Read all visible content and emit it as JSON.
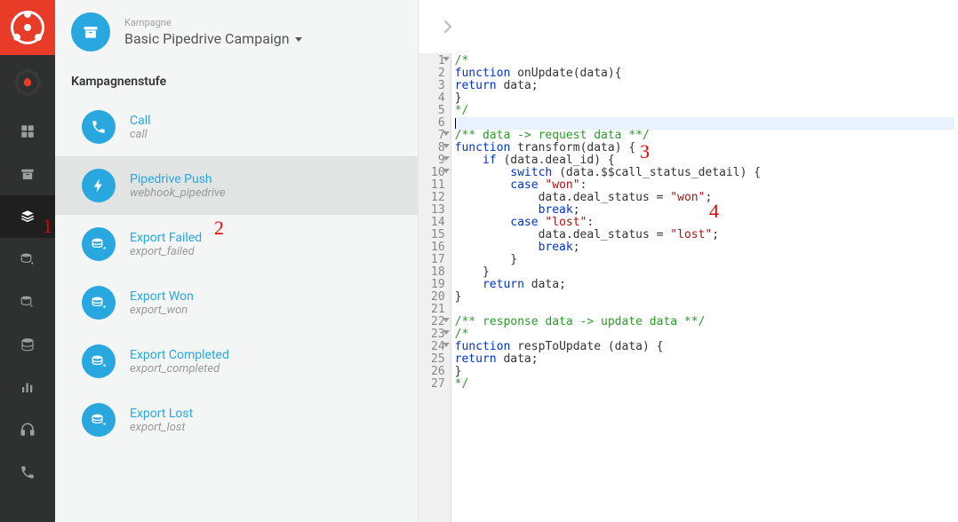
{
  "header": {
    "label": "Kampagne",
    "title": "Basic Pipedrive Campaign"
  },
  "section_label": "Kampagnenstufe",
  "stages": [
    {
      "title": "Call",
      "sub": "call",
      "icon": "phone"
    },
    {
      "title": "Pipedrive Push",
      "sub": "webhook_pipedrive",
      "icon": "bolt"
    },
    {
      "title": "Export Failed",
      "sub": "export_failed",
      "icon": "db-arrow"
    },
    {
      "title": "Export Won",
      "sub": "export_won",
      "icon": "db-arrow"
    },
    {
      "title": "Export Completed",
      "sub": "export_completed",
      "icon": "db-arrow"
    },
    {
      "title": "Export Lost",
      "sub": "export_lost",
      "icon": "db-arrow"
    }
  ],
  "selected_stage_index": 1,
  "nav_active_index": 2,
  "annotations": {
    "a1": "1",
    "a2": "2",
    "a3": "3",
    "a4": "4"
  },
  "code": {
    "total_lines": 27,
    "fold_lines": [
      1,
      7,
      8,
      9,
      10,
      22,
      23,
      24
    ],
    "highlight_line": 6,
    "lines": [
      [
        {
          "c": "comment",
          "t": "/*"
        }
      ],
      [
        {
          "c": "kw",
          "t": "function"
        },
        {
          "c": "plain",
          "t": " onUpdate(data){"
        }
      ],
      [
        {
          "c": "kw",
          "t": "return"
        },
        {
          "c": "plain",
          "t": " data;"
        }
      ],
      [
        {
          "c": "plain",
          "t": "}"
        }
      ],
      [
        {
          "c": "comment",
          "t": "*/"
        }
      ],
      [
        {
          "c": "cursor",
          "t": ""
        }
      ],
      [
        {
          "c": "comment",
          "t": "/** data -> request data **/"
        }
      ],
      [
        {
          "c": "kw",
          "t": "function"
        },
        {
          "c": "plain",
          "t": " "
        },
        {
          "c": "fn",
          "t": "transform"
        },
        {
          "c": "plain",
          "t": "(data) {"
        }
      ],
      [
        {
          "c": "plain",
          "t": "    "
        },
        {
          "c": "kw",
          "t": "if"
        },
        {
          "c": "plain",
          "t": " (data.deal_id) {"
        }
      ],
      [
        {
          "c": "plain",
          "t": "        "
        },
        {
          "c": "kw",
          "t": "switch"
        },
        {
          "c": "plain",
          "t": " (data.$$call_status_detail) {"
        }
      ],
      [
        {
          "c": "plain",
          "t": "        "
        },
        {
          "c": "kw",
          "t": "case"
        },
        {
          "c": "plain",
          "t": " "
        },
        {
          "c": "str",
          "t": "\"won\""
        },
        {
          "c": "plain",
          "t": ":"
        }
      ],
      [
        {
          "c": "plain",
          "t": "            data.deal_status = "
        },
        {
          "c": "str",
          "t": "\"won\""
        },
        {
          "c": "plain",
          "t": ";"
        }
      ],
      [
        {
          "c": "plain",
          "t": "            "
        },
        {
          "c": "kw",
          "t": "break"
        },
        {
          "c": "plain",
          "t": ";"
        }
      ],
      [
        {
          "c": "plain",
          "t": "        "
        },
        {
          "c": "kw",
          "t": "case"
        },
        {
          "c": "plain",
          "t": " "
        },
        {
          "c": "str",
          "t": "\"lost\""
        },
        {
          "c": "plain",
          "t": ":"
        }
      ],
      [
        {
          "c": "plain",
          "t": "            data.deal_status = "
        },
        {
          "c": "str",
          "t": "\"lost\""
        },
        {
          "c": "plain",
          "t": ";"
        }
      ],
      [
        {
          "c": "plain",
          "t": "            "
        },
        {
          "c": "kw",
          "t": "break"
        },
        {
          "c": "plain",
          "t": ";"
        }
      ],
      [
        {
          "c": "plain",
          "t": "        }"
        }
      ],
      [
        {
          "c": "plain",
          "t": "    }"
        }
      ],
      [
        {
          "c": "plain",
          "t": "    "
        },
        {
          "c": "kw",
          "t": "return"
        },
        {
          "c": "plain",
          "t": " data;"
        }
      ],
      [
        {
          "c": "plain",
          "t": "}"
        }
      ],
      [],
      [
        {
          "c": "comment",
          "t": "/** response data -> update data **/"
        }
      ],
      [
        {
          "c": "comment",
          "t": "/*"
        }
      ],
      [
        {
          "c": "kw",
          "t": "function"
        },
        {
          "c": "plain",
          "t": " respToUpdate (data) {"
        }
      ],
      [
        {
          "c": "kw",
          "t": "return"
        },
        {
          "c": "plain",
          "t": " data;"
        }
      ],
      [
        {
          "c": "plain",
          "t": "}"
        }
      ],
      [
        {
          "c": "comment",
          "t": "*/"
        }
      ]
    ]
  }
}
